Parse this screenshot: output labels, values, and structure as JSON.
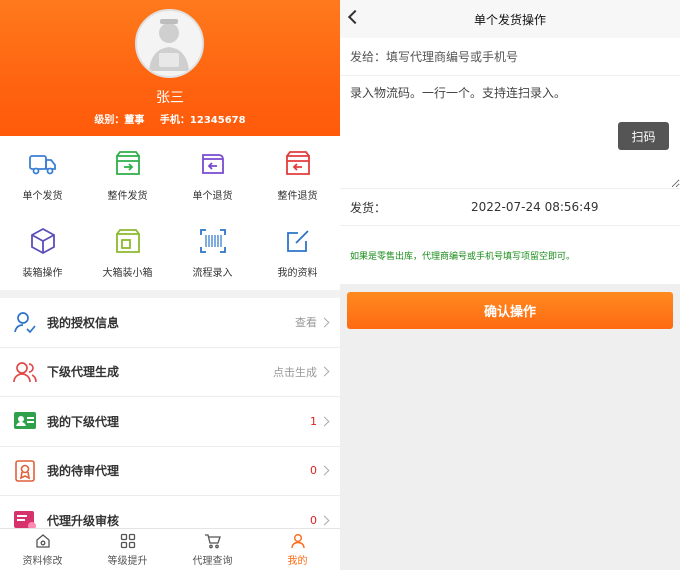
{
  "profile": {
    "name": "张三",
    "level_label": "级别：董事",
    "phone_label": "手机：12345678"
  },
  "quick_actions": [
    {
      "label": "单个发货",
      "icon": "truck-icon"
    },
    {
      "label": "整件发货",
      "icon": "box-forward-icon"
    },
    {
      "label": "单个退货",
      "icon": "return-box-icon"
    },
    {
      "label": "整件退货",
      "icon": "return-package-icon"
    },
    {
      "label": "装箱操作",
      "icon": "cube-icon"
    },
    {
      "label": "大箱装小箱",
      "icon": "box-in-box-icon"
    },
    {
      "label": "流程录入",
      "icon": "barcode-scan-icon"
    },
    {
      "label": "我的资料",
      "icon": "edit-icon"
    }
  ],
  "menu": [
    {
      "label": "我的授权信息",
      "value": "查看",
      "icon": "user-check-icon"
    },
    {
      "label": "下级代理生成",
      "value": "点击生成",
      "icon": "users-icon"
    },
    {
      "label": "我的下级代理",
      "value": "1",
      "icon": "id-card-icon"
    },
    {
      "label": "我的待审代理",
      "value": "0",
      "icon": "certificate-icon"
    },
    {
      "label": "代理升级审核",
      "value": "0",
      "icon": "upgrade-card-icon"
    }
  ],
  "tabbar": [
    {
      "label": "资料修改",
      "icon": "home-icon"
    },
    {
      "label": "等级提升",
      "icon": "grid-icon"
    },
    {
      "label": "代理查询",
      "icon": "cart-icon"
    },
    {
      "label": "我的",
      "icon": "person-icon"
    }
  ],
  "shipping": {
    "title": "单个发货操作",
    "to_placeholder": "发给：填写代理商编号或手机号",
    "logistics_placeholder": "录入物流码。一行一个。支持连扫录入。",
    "scan_label": "扫码",
    "ship_label": "发货：",
    "ship_date": "2022-07-24 08:56:49",
    "hint": "如果是零售出库，代理商编号或手机号填写项留空即可。",
    "confirm_label": "确认操作"
  },
  "colors": {
    "accent": "#ff6a14",
    "hint": "#1a8c1a",
    "badge_red": "#e02020"
  }
}
